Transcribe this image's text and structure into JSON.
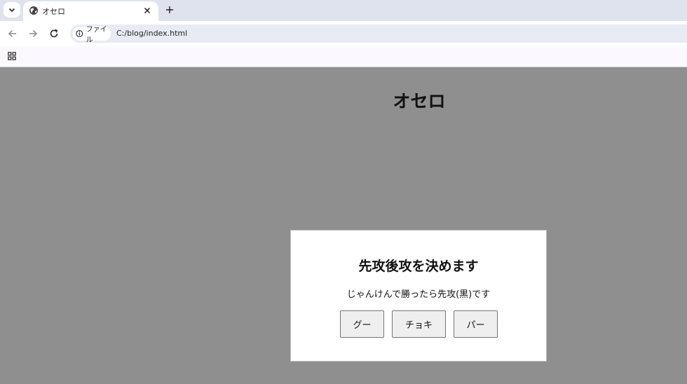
{
  "browser": {
    "tab": {
      "title": "オセロ"
    },
    "omnibox": {
      "site_label": "ファイル",
      "url": "C:/blog/index.html"
    }
  },
  "page": {
    "title": "オセロ",
    "dialog": {
      "title": "先攻後攻を決めます",
      "message": "じゃんけんで勝ったら先攻(黒)です",
      "buttons": {
        "rock": "グー",
        "scissors": "チョキ",
        "paper": "パー"
      }
    }
  },
  "colors": {
    "page_background": "#8f8f8f",
    "dialog_background": "#ffffff",
    "button_background": "#efefef"
  },
  "icons": [
    "tab-search-icon",
    "globe-icon",
    "close-icon",
    "plus-icon",
    "back-arrow-icon",
    "forward-arrow-icon",
    "reload-icon",
    "info-icon",
    "apps-grid-icon"
  ]
}
